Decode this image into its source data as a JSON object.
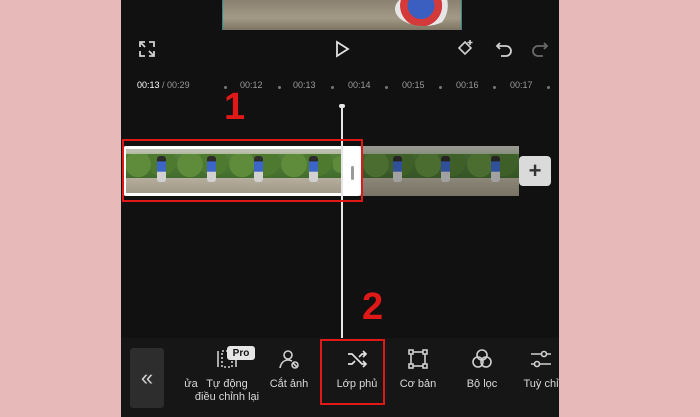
{
  "preview": {
    "fullscreen_icon": "expand-icon",
    "play_icon": "play-icon",
    "keyframe_icon": "keyframe-icon",
    "undo_icon": "undo-icon",
    "redo_icon": "redo-icon"
  },
  "ruler": {
    "current": "00:13",
    "separator": " / ",
    "total": "00:29",
    "ticks": [
      "00:12",
      "00:13",
      "00:14",
      "00:15",
      "00:16",
      "00:17"
    ]
  },
  "timeline": {
    "add_icon": "plus-icon",
    "add_label": "+"
  },
  "annotations": {
    "step1": "1",
    "step2": "2"
  },
  "toolbar": {
    "collapse_label": "«",
    "pro_badge": "Pro",
    "items": [
      {
        "label": "ửa",
        "icon": "edit-icon"
      },
      {
        "label": "Tự động\nđiều chỉnh lại",
        "icon": "auto-reframe-icon"
      },
      {
        "label": "Cắt ảnh",
        "icon": "cutout-icon"
      },
      {
        "label": "Lớp phủ",
        "icon": "overlay-icon"
      },
      {
        "label": "Cơ bản",
        "icon": "basic-icon"
      },
      {
        "label": "Bộ lọc",
        "icon": "filter-icon"
      },
      {
        "label": "Tuỳ chỉ",
        "icon": "adjust-icon"
      }
    ]
  },
  "colors": {
    "accent_red": "#e01818",
    "background": "#e8b9b9",
    "app_bg": "#111111"
  }
}
